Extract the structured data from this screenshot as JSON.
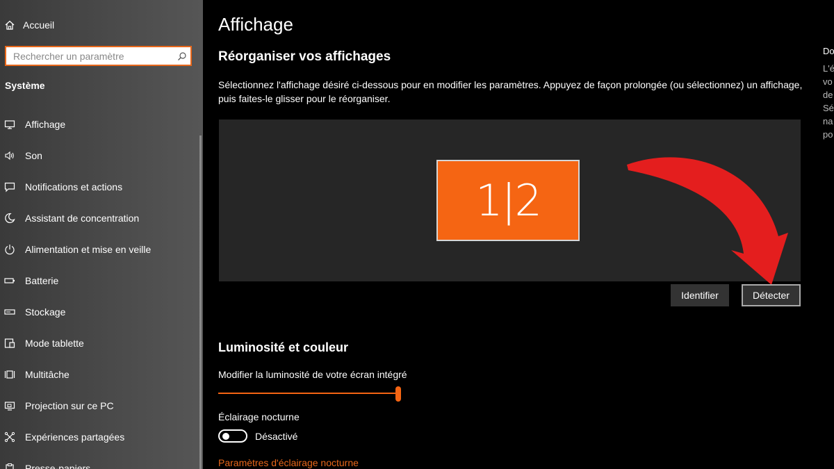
{
  "sidebar": {
    "home_label": "Accueil",
    "search_placeholder": "Rechercher un paramètre",
    "section_title": "Système",
    "items": [
      {
        "label": "Affichage",
        "icon": "monitor-icon"
      },
      {
        "label": "Son",
        "icon": "speaker-icon"
      },
      {
        "label": "Notifications et actions",
        "icon": "notification-icon"
      },
      {
        "label": "Assistant de concentration",
        "icon": "moon-icon"
      },
      {
        "label": "Alimentation et mise en veille",
        "icon": "power-icon"
      },
      {
        "label": "Batterie",
        "icon": "battery-icon"
      },
      {
        "label": "Stockage",
        "icon": "storage-icon"
      },
      {
        "label": "Mode tablette",
        "icon": "tablet-icon"
      },
      {
        "label": "Multitâche",
        "icon": "multitask-icon"
      },
      {
        "label": "Projection sur ce PC",
        "icon": "projection-icon"
      },
      {
        "label": "Expériences partagées",
        "icon": "shared-icon"
      },
      {
        "label": "Presse-papiers",
        "icon": "clipboard-icon"
      }
    ]
  },
  "main": {
    "title": "Affichage",
    "rearrange_heading": "Réorganiser vos affichages",
    "rearrange_desc": "Sélectionnez l'affichage désiré ci-dessous pour en modifier les paramètres. Appuyez de façon prolongée (ou sélectionnez) un affichage, puis faites-le glisser pour le réorganiser.",
    "monitor_label": "1|2",
    "identify_button": "Identifier",
    "detect_button": "Détecter",
    "brightness_heading": "Luminosité et couleur",
    "brightness_label": "Modifier la luminosité de votre écran intégré",
    "brightness_value": 1.0,
    "night_light_label": "Éclairage nocturne",
    "night_light_status": "Désactivé",
    "night_light_link": "Paramètres d'éclairage nocturne"
  },
  "right_col": {
    "title": "Do",
    "lines": [
      "L'é",
      "vo",
      "de",
      "Sé",
      "na",
      "po"
    ]
  },
  "colors": {
    "accent": "#e8671a",
    "monitor": "#f56513",
    "arrow": "#e41e1e"
  }
}
